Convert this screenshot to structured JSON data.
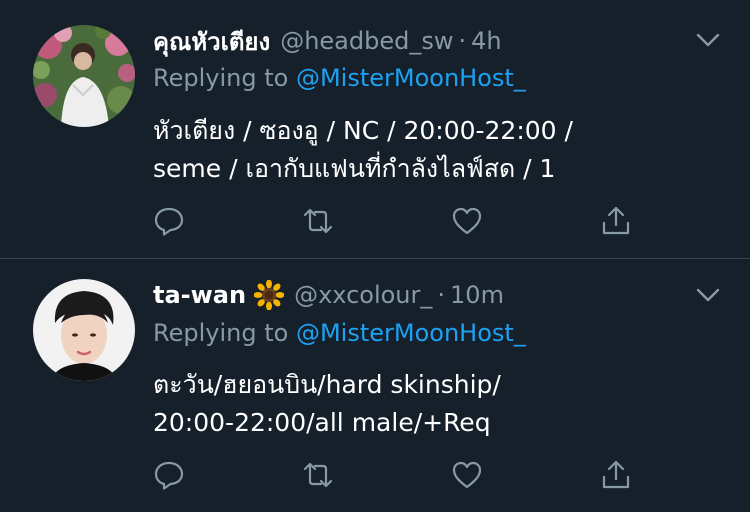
{
  "colors": {
    "background": "#15202b",
    "divider": "#38444d",
    "muted_text": "#8899a6",
    "link": "#1da1f2",
    "primary_text": "#ffffff"
  },
  "tweets": [
    {
      "display_name": "คุณหัวเตียง",
      "emoji": "",
      "handle": "@headbed_sw",
      "separator": "·",
      "time": "4h",
      "replying_prefix": "Replying to",
      "replying_to": "@MisterMoonHost_",
      "body_lines": [
        "หัวเตียง / ซองอู / NC / 20:00-22:00 /",
        "seme / เอากับแฟนที่กำลังไลฟ์สด / 1"
      ],
      "avatar_icon": "avatar-photo",
      "actions": [
        "reply-icon",
        "retweet-icon",
        "like-icon",
        "share-icon"
      ]
    },
    {
      "display_name": "ta-wan",
      "emoji": "sunflower-emoji",
      "handle": "@xxcolour_",
      "separator": "·",
      "time": "10m",
      "replying_prefix": "Replying to",
      "replying_to": "@MisterMoonHost_",
      "body_lines": [
        "ตะวัน/ฮยอนบิน/hard skinship/",
        "20:00-22:00/all male/+Req"
      ],
      "avatar_icon": "avatar-photo",
      "actions": [
        "reply-icon",
        "retweet-icon",
        "like-icon",
        "share-icon"
      ]
    }
  ]
}
